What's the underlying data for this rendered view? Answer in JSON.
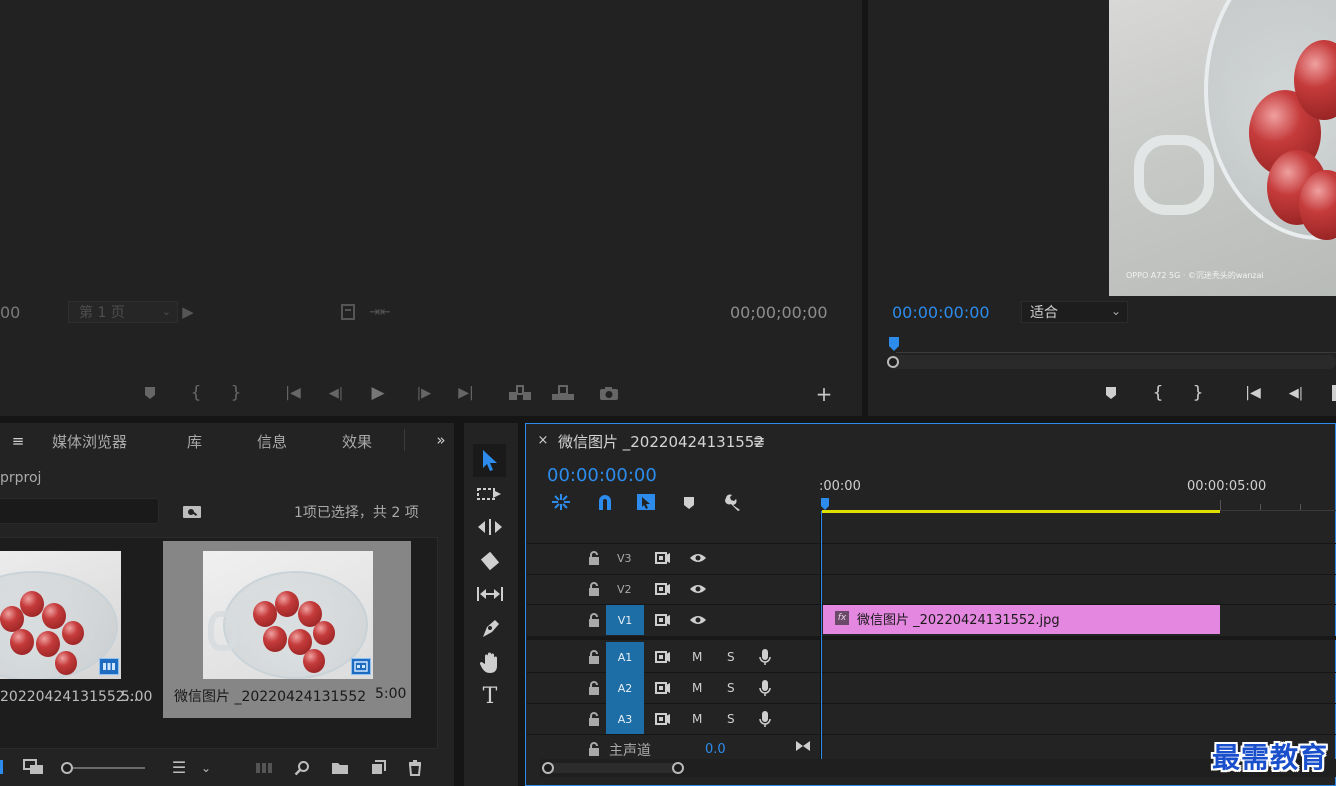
{
  "source_monitor": {
    "timecode_left": "00",
    "page_select": "第 1 页",
    "timecode_right": "00;00;00;00"
  },
  "program_monitor": {
    "timecode": "00:00:00:00",
    "zoom": "适合",
    "photo_watermark": "OPPO A72 5G · ©沉迷秃头的wanzai"
  },
  "project_panel": {
    "tabs": [
      "媒体浏览器",
      "库",
      "信息",
      "效果"
    ],
    "project_name": "prproj",
    "selection_status": "1项已选择，共 2 项",
    "items": [
      {
        "name": "20220424131552...",
        "duration": "5:00"
      },
      {
        "name": "微信图片 _20220424131552",
        "duration": "5:00"
      }
    ]
  },
  "timeline": {
    "sequence_name": "微信图片 _20220424131552",
    "timecode": "00:00:00:00",
    "ruler_labels": [
      ":00:00",
      "00:00:05:00"
    ],
    "video_tracks": [
      "V3",
      "V2",
      "V1"
    ],
    "audio_tracks": [
      "A1",
      "A2",
      "A3"
    ],
    "mute_label": "M",
    "solo_label": "S",
    "master_label": "主声道",
    "master_value": "0.0",
    "clip_name": "微信图片 _20220424131552.jpg",
    "clip_fx": "fx"
  },
  "watermark": "最需教育",
  "colors": {
    "accent_blue": "#2d8ceb",
    "track_target": "#1d6ea7",
    "clip_pink": "#e487e0",
    "work_area_yellow": "#e0e000"
  }
}
